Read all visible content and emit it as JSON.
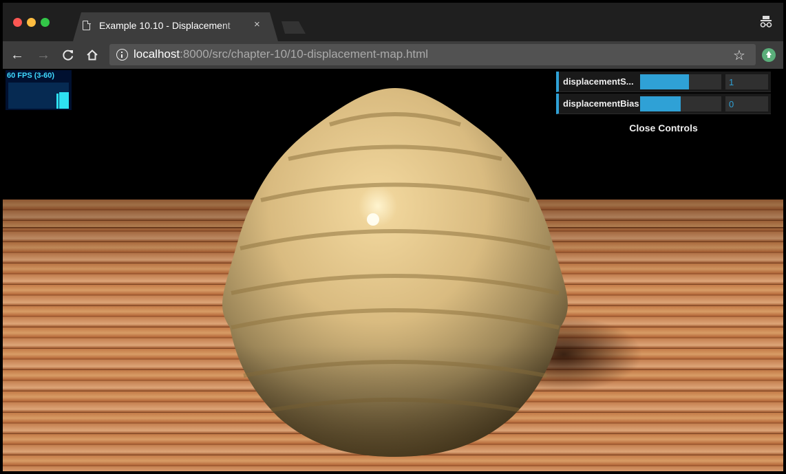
{
  "window": {
    "tab_title": "Example 10.10 - Displacement",
    "tab_close": "×"
  },
  "toolbar": {
    "back_icon": "←",
    "forward_icon": "→",
    "reload_icon": "C",
    "home_icon": "⌂",
    "url_host": "localhost",
    "url_path": ":8000/src/chapter-10/10-displacement-map.html",
    "star_icon": "☆"
  },
  "stats": {
    "label": "60 FPS (3-60)"
  },
  "gui": {
    "controls": [
      {
        "label": "displacementS...",
        "value": "1",
        "level": 0.6
      },
      {
        "label": "displacementBias",
        "value": "0",
        "level": 0.5
      }
    ],
    "close_label": "Close Controls"
  },
  "colors": {
    "accent": "#2fa1d6",
    "stats_text": "#3fd9ff"
  }
}
